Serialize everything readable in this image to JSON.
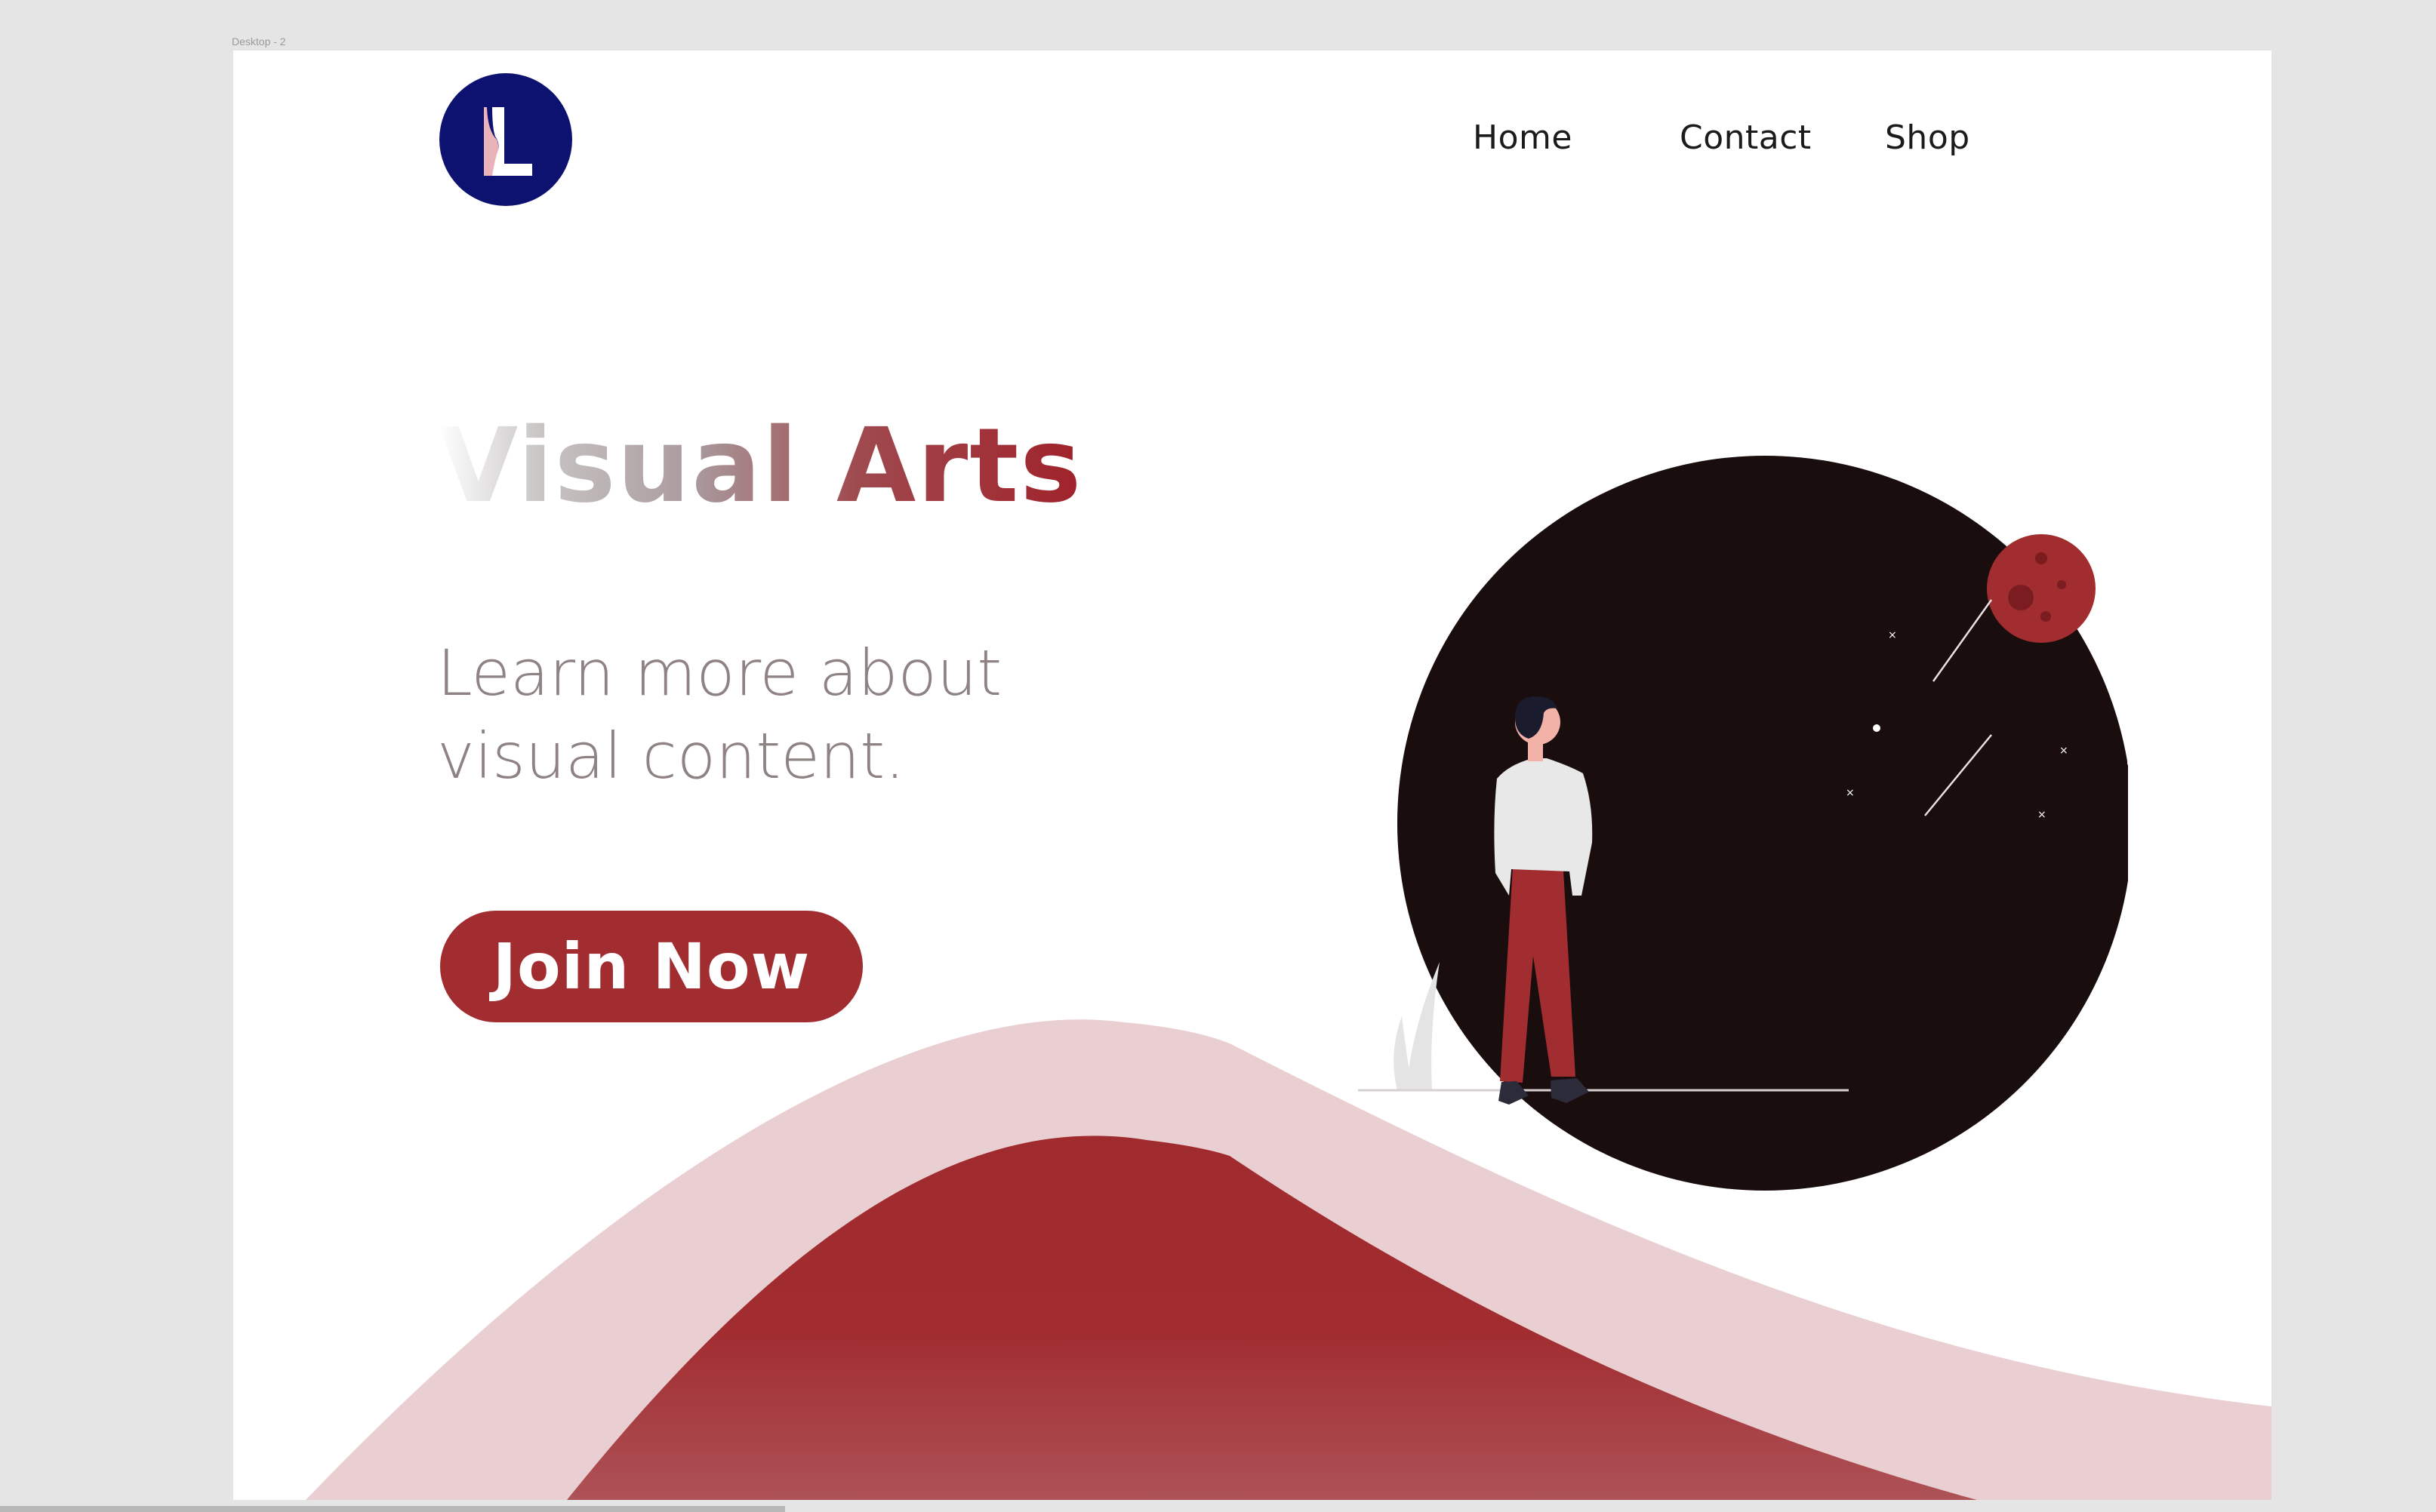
{
  "canvas": {
    "frame_label": "Desktop - 2"
  },
  "brand": {
    "logo_letter": "L",
    "primary_color": "#0d1170",
    "accent_color": "#a12d31"
  },
  "nav": {
    "items": [
      {
        "label": "Home"
      },
      {
        "label": "Contact"
      },
      {
        "label": "Shop"
      }
    ]
  },
  "hero": {
    "title": "Visual Arts",
    "subtitle_line1": "Learn more about",
    "subtitle_line2": "visual content.",
    "cta_label": "Join Now"
  },
  "colors": {
    "wave_light": "#e9cfd1",
    "wave_dark": "#a02b2f",
    "night_circle": "#1a0d0d",
    "planet": "#a12d31"
  }
}
